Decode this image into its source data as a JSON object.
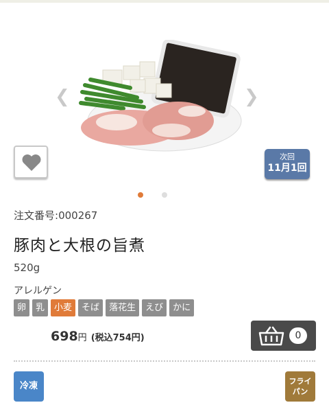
{
  "product": {
    "order_number_label": "注文番号:",
    "order_number": "000267",
    "name": "豚肉と大根の旨煮",
    "weight": "520g",
    "allergen_label": "アレルゲン",
    "allergens": [
      {
        "label": "卵",
        "active": false
      },
      {
        "label": "乳",
        "active": false
      },
      {
        "label": "小麦",
        "active": true
      },
      {
        "label": "そば",
        "active": false
      },
      {
        "label": "落花生",
        "active": false
      },
      {
        "label": "えび",
        "active": false
      },
      {
        "label": "かに",
        "active": false
      }
    ],
    "price": "698",
    "price_unit": "円",
    "price_tax": "(税込754円)"
  },
  "next_delivery": {
    "line1": "次回",
    "line2": "11月1回"
  },
  "cart": {
    "count": "0"
  },
  "badges": {
    "storage": "冷凍",
    "cook_method": "フライパン"
  },
  "carousel": {
    "active_index": 0,
    "total": 2
  },
  "colors": {
    "accent": "#e07b39",
    "next_bg": "#5a79a7",
    "storage_bg": "#4a86c8",
    "cook_bg": "#a07a3a",
    "cart_bg": "#4a4a4a"
  },
  "icons": [
    "chevron-left-icon",
    "chevron-right-icon",
    "heart-icon",
    "basket-icon"
  ]
}
